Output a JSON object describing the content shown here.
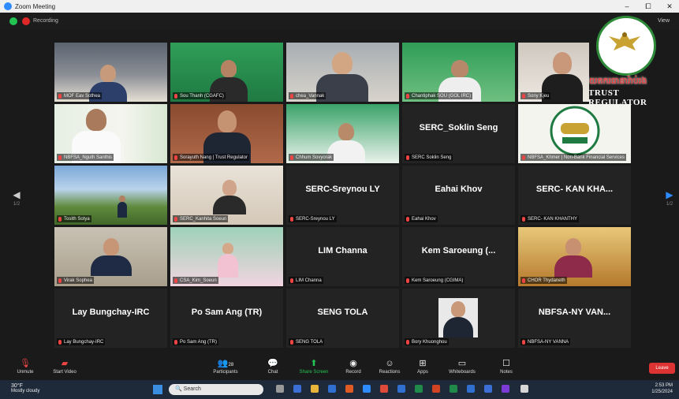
{
  "window": {
    "title": "Zoom Meeting",
    "min": "–",
    "max": "⧠",
    "close": "✕"
  },
  "topbar": {
    "recording": "Recording",
    "view": "View"
  },
  "logo": {
    "khmer": "និយតករធានារ៉ាប់រង",
    "english": "TRUST REGULATOR"
  },
  "nav": {
    "prev": "◀",
    "next": "▶",
    "prev_page": "1/2",
    "next_page": "1/2"
  },
  "participants": [
    {
      "label": "MOF Eav Sothea",
      "center": "",
      "active": true
    },
    {
      "label": "Sou Thanh (CGAFC)",
      "center": ""
    },
    {
      "label": "chea_Vannak",
      "center": ""
    },
    {
      "label": "Chantiphak SOU (GOL IRC)",
      "center": ""
    },
    {
      "label": "Sony Kjeu",
      "center": ""
    },
    {
      "label": "NBFSA_Nguth Santhis",
      "center": ""
    },
    {
      "label": "Sorayuth Nang | Trust Regulator",
      "center": ""
    },
    {
      "label": "Chhum Sovyorak",
      "center": ""
    },
    {
      "label": "SERC Soklin Seng",
      "center": "SERC_Soklin Seng"
    },
    {
      "label": "NBFSA_Khmer | Non-Bank Financial Services",
      "center": ""
    },
    {
      "label": "Tosith Sotya",
      "center": ""
    },
    {
      "label": "SERC_Kanhita Soeun",
      "center": ""
    },
    {
      "label": "SERC-Sreynou LY",
      "center": "SERC-Sreynou LY"
    },
    {
      "label": "Eahai Khov",
      "center": "Eahai Khov"
    },
    {
      "label": "SERC- KAN KHANTHY",
      "center": "SERC- KAN KHA..."
    },
    {
      "label": "Virak Sophea",
      "center": ""
    },
    {
      "label": "CSA_Kim_Soeun",
      "center": ""
    },
    {
      "label": "LIM Channa",
      "center": "LIM Channa"
    },
    {
      "label": "Kem Saroeung (CGIMA)",
      "center": "Kem Saroeung (..."
    },
    {
      "label": "CHOR Thydaneth",
      "center": ""
    },
    {
      "label": "Lay Bungchay-IRC",
      "center": "Lay Bungchay-IRC"
    },
    {
      "label": "Po Sam Ang (TR)",
      "center": "Po Sam Ang (TR)"
    },
    {
      "label": "SENG TOLA",
      "center": "SENG TOLA"
    },
    {
      "label": "Bory Khuonghou",
      "center": ""
    },
    {
      "label": "NBFSA-NY VANNA",
      "center": "NBFSA-NY VAN..."
    }
  ],
  "toolbar": {
    "unmute": "Unmute",
    "video": "Start Video",
    "participants": "Participants",
    "participants_count": "28",
    "chat": "Chat",
    "share": "Share Screen",
    "record": "Record",
    "reactions": "Reactions",
    "apps": "Apps",
    "whiteboards": "Whiteboards",
    "notes": "Notes",
    "leave": "Leave"
  },
  "taskbar": {
    "temp": "30°F",
    "weather": "Mostly cloudy",
    "search": "Search",
    "time": "2:53 PM",
    "date": "1/25/2024"
  },
  "colors": {
    "accent": "#2d8cff",
    "share": "#23c552",
    "leave": "#d33",
    "active_border": "#e8d36a"
  }
}
